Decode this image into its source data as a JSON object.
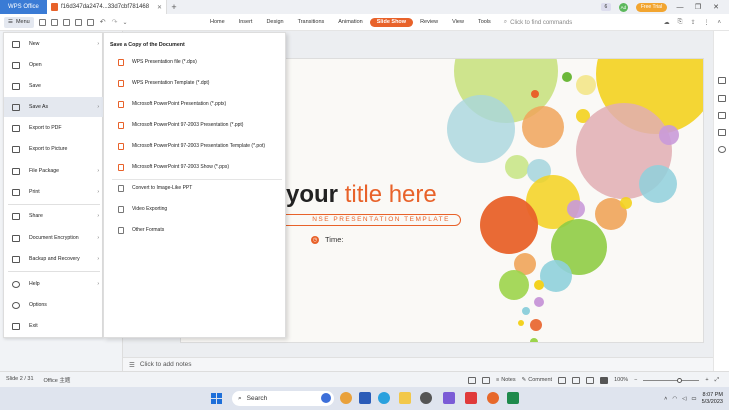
{
  "titlebar": {
    "app_tab": "WPS Office",
    "doc_tab": "f16d347da2474...33d7cbf781468",
    "badge": "6",
    "user_initials": "Ad",
    "free_trial": "Free Trial"
  },
  "ribbon": {
    "menu_label": "Menu",
    "tabs": [
      {
        "label": "Home",
        "active": false
      },
      {
        "label": "Insert",
        "active": false
      },
      {
        "label": "Design",
        "active": false
      },
      {
        "label": "Transitions",
        "active": false
      },
      {
        "label": "Animation",
        "active": false
      },
      {
        "label": "Slide Show",
        "active": true
      },
      {
        "label": "Review",
        "active": false
      },
      {
        "label": "View",
        "active": false
      },
      {
        "label": "Tools",
        "active": false
      }
    ],
    "find_placeholder": "Click to find commands"
  },
  "menu": {
    "items": [
      {
        "label": "New",
        "icon": "new-file-icon",
        "arrow": true
      },
      {
        "label": "Open",
        "icon": "folder-icon",
        "arrow": false
      },
      {
        "label": "Save",
        "icon": "save-icon",
        "arrow": false
      },
      {
        "label": "Save As",
        "icon": "save-as-icon",
        "arrow": true
      },
      {
        "label": "Export to PDF",
        "icon": "pdf-icon",
        "arrow": false
      },
      {
        "label": "Export to Picture",
        "icon": "picture-icon",
        "arrow": false
      },
      {
        "label": "File Package",
        "icon": "package-icon",
        "arrow": true
      },
      {
        "label": "Print",
        "icon": "print-icon",
        "arrow": true
      },
      {
        "label": "Share",
        "icon": "share-icon",
        "arrow": true
      },
      {
        "label": "Document Encryption",
        "icon": "lock-icon",
        "arrow": true
      },
      {
        "label": "Backup and Recovery",
        "icon": "backup-icon",
        "arrow": true
      },
      {
        "label": "Help",
        "icon": "help-icon",
        "arrow": true
      },
      {
        "label": "Options",
        "icon": "gear-icon",
        "arrow": false
      },
      {
        "label": "Exit",
        "icon": "exit-icon",
        "arrow": false
      }
    ]
  },
  "submenu": {
    "title": "Save a Copy of the Document",
    "items": [
      {
        "label": "WPS Presentation file (*.dps)",
        "icon": "dps-file-icon"
      },
      {
        "label": "WPS Presentation Template (*.dpt)",
        "icon": "dpt-file-icon"
      },
      {
        "label": "Microsoft PowerPoint Presentation (*.pptx)",
        "icon": "pptx-file-icon"
      },
      {
        "label": "Microsoft PowerPoint 97-2003 Presentation (*.ppt)",
        "icon": "ppt-file-icon"
      },
      {
        "label": "Microsoft PowerPoint 97-2003 Presentation Template (*.pot)",
        "icon": "pot-file-icon"
      },
      {
        "label": "Microsoft PowerPoint 97-2003 Show (*.pps)",
        "icon": "pps-file-icon"
      },
      {
        "label": "Convert to Image-Like PPT",
        "icon": "image-ppt-icon"
      },
      {
        "label": "Video Exporting",
        "icon": "video-icon"
      },
      {
        "label": "Other Formats",
        "icon": "other-formats-icon"
      }
    ]
  },
  "thumbnails": {
    "visible_number": "5"
  },
  "slide": {
    "title_main": "your",
    "title_accent": "title here",
    "subtitle": "NSE PRESENTATION TEMPLATE",
    "time_label": "Time:",
    "bubble_colors": [
      "#e8622a",
      "#f3d21f",
      "#9cd44b",
      "#8fd0dc",
      "#e8a7b1",
      "#c99ad9",
      "#f0a45a"
    ]
  },
  "notes": {
    "placeholder": "Click to add notes"
  },
  "statusbar": {
    "slide_info": "Slide 2 / 31",
    "theme": "Office 主题",
    "notes_label": "Notes",
    "comment_label": "Comment",
    "zoom": "100%"
  },
  "taskbar": {
    "search_label": "Search",
    "weather_label": "",
    "time": "8:07 PM",
    "date": "5/3/2023"
  }
}
